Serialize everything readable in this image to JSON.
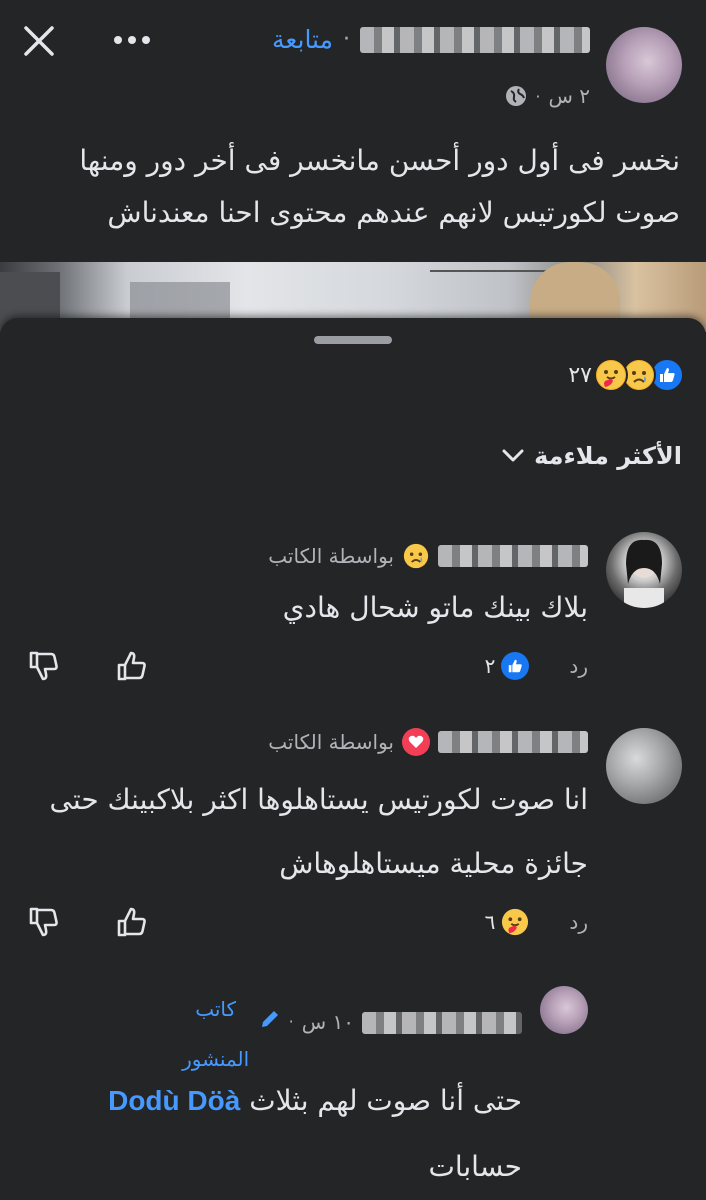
{
  "post": {
    "follow_label": "متابعة",
    "time": "٢ س",
    "text": "نخسر فى أول دور أحسن مانخسر  فى أخر دور ومنها صوت لكورتيس لانهم عندهم محتوى احنا معندناش"
  },
  "reactions_summary": {
    "count": "٢٧",
    "icons": [
      "like-icon",
      "sad-icon",
      "care-icon"
    ]
  },
  "sort": {
    "label": "الأكثر ملاءمة"
  },
  "comments": [
    {
      "by_author": "بواسطة الكاتب",
      "author_reaction": "sad-icon",
      "text": "بلاك بينك ماتو شحال هادي",
      "reply_label": "رد",
      "reaction_count": "٢",
      "reaction_icon": "like-icon"
    },
    {
      "by_author": "بواسطة الكاتب",
      "author_reaction": "love-icon",
      "text": "انا صوت لكورتيس يستاهلوها اكثر بلاكبينك حتى جائزة محلية ميستاهلوهاش",
      "reply_label": "رد",
      "reaction_count": "٦",
      "reaction_icon": "care-icon"
    }
  ],
  "reply": {
    "time": "١٠ س",
    "badge": "كاتب المنشور",
    "mention": "Dodù Döà",
    "text_before": "حتى أنا صوت لهم بثلاث",
    "text_after": "حسابات"
  },
  "colors": {
    "background": "#242526",
    "accent": "#4599ff",
    "text": "#e4e6eb",
    "muted": "#b0b3b8"
  }
}
